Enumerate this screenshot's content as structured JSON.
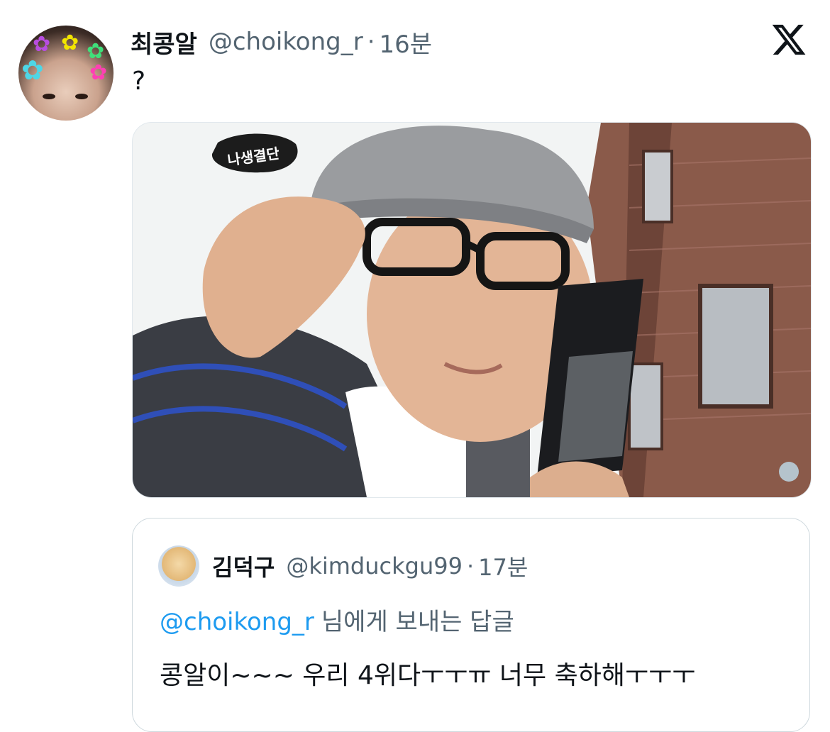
{
  "tweet": {
    "display_name": "최콩알",
    "handle": "@choikong_r",
    "separator": "·",
    "time": "16분",
    "text": "?"
  },
  "media": {
    "channel_logo_text": "나생결단"
  },
  "quoted_tweet": {
    "display_name": "김덕구",
    "handle": "@kimduckgu99",
    "separator": "·",
    "time": "17분",
    "reply_to_handle": "@choikong_r",
    "reply_to_suffix": "님에게 보내는 답글",
    "text": "콩알이~~~ 우리 4위다ㅜㅜㅠ 너무 축하해ㅜㅜㅜ"
  },
  "icons": {
    "brand": "x-logo-icon",
    "avatar": "user-avatar",
    "quoted_avatar": "quoted-user-avatar"
  },
  "colors": {
    "text_primary": "#0f1419",
    "text_secondary": "#536471",
    "link": "#1d9bf0",
    "border": "#cfd9de"
  }
}
